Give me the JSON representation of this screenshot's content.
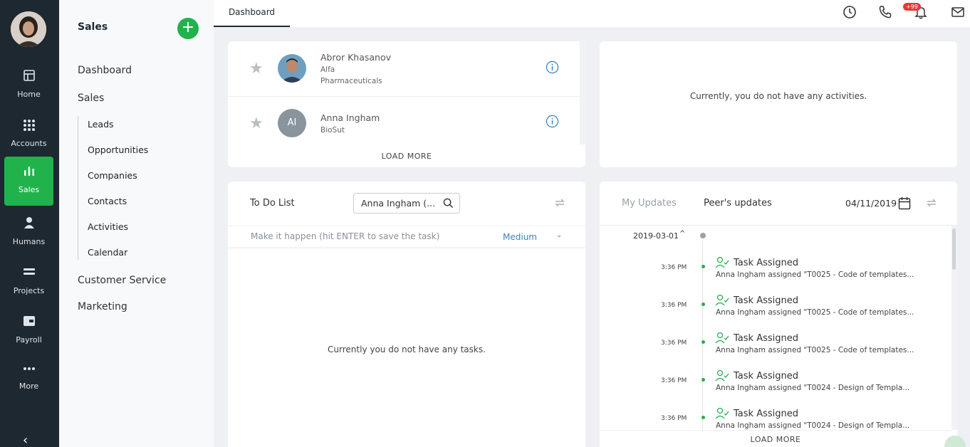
{
  "rail": {
    "items": [
      {
        "label": "Home",
        "icon": "home-icon"
      },
      {
        "label": "Accounts",
        "icon": "grid-icon"
      },
      {
        "label": "Sales",
        "icon": "bar-chart-icon"
      },
      {
        "label": "Humans",
        "icon": "person-icon"
      },
      {
        "label": "Projects",
        "icon": "projects-icon"
      },
      {
        "label": "Payroll",
        "icon": "wallet-icon"
      },
      {
        "label": "More",
        "icon": "more-icon"
      }
    ],
    "active": "Sales",
    "accent": "#22b24c",
    "collapse": "‹"
  },
  "subnav": {
    "title": "Sales",
    "add": "+",
    "top_items": [
      "Dashboard",
      "Sales"
    ],
    "sub_items": [
      "Leads",
      "Opportunities",
      "Companies",
      "Contacts",
      "Activities",
      "Calendar"
    ],
    "bottom_items": [
      "Customer Service",
      "Marketing"
    ]
  },
  "topbar": {
    "tab": "Dashboard",
    "badge": "+99"
  },
  "contacts": {
    "rows": [
      {
        "name": "Abror Khasanov",
        "company_line1": "Alfa",
        "company_line2": "Pharmaceuticals",
        "initials": ""
      },
      {
        "name": "Anna Ingham",
        "company_line1": "BioSut",
        "company_line2": "",
        "initials": "AI"
      }
    ],
    "load_more": "LOAD MORE"
  },
  "activities": {
    "empty": "Currently, you do not have any activities."
  },
  "todo": {
    "title": "To Do List",
    "search_value": "Anna Ingham (...",
    "placeholder": "Make it happen (hit ENTER to save the task)",
    "priority": "Medium",
    "empty": "Currently you do not have any tasks."
  },
  "updates": {
    "tab_mine": "My Updates",
    "tab_peer": "Peer's updates",
    "date": "04/11/2019",
    "group_date": "2019-03-01",
    "items": [
      {
        "time": "3:36 PM",
        "title": "Task Assigned",
        "desc": "Anna Ingham assigned \"T0025 - Code of templates..."
      },
      {
        "time": "3:36 PM",
        "title": "Task Assigned",
        "desc": "Anna Ingham assigned \"T0025 - Code of templates..."
      },
      {
        "time": "3:36 PM",
        "title": "Task Assigned",
        "desc": "Anna Ingham assigned \"T0025 - Code of templates..."
      },
      {
        "time": "3:36 PM",
        "title": "Task Assigned",
        "desc": "Anna Ingham assigned \"T0024 - Design of Templa..."
      },
      {
        "time": "3:36 PM",
        "title": "Task Assigned",
        "desc": "Anna Ingham assigned \"T0024 - Design of Templa..."
      }
    ],
    "load_more": "LOAD MORE"
  }
}
